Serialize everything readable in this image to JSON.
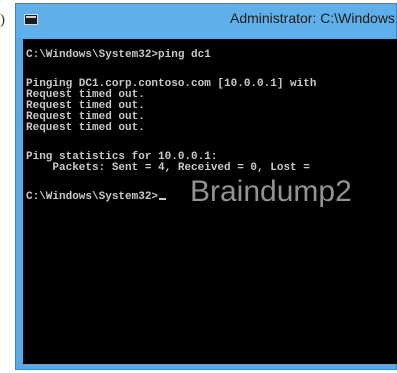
{
  "margin_text": ")",
  "window": {
    "title": "Administrator: C:\\Windows",
    "icon": "cmd-icon"
  },
  "console": {
    "lines": [
      "C:\\Windows\\System32>ping dc1",
      "Pinging DC1.corp.contoso.com [10.0.0.1] with",
      "Request timed out.",
      "Request timed out.",
      "Request timed out.",
      "Request timed out.",
      "Ping statistics for 10.0.0.1:",
      "    Packets: Sent = 4, Received = 0, Lost =",
      "C:\\Windows\\System32>"
    ]
  },
  "watermark": "Braindump2"
}
